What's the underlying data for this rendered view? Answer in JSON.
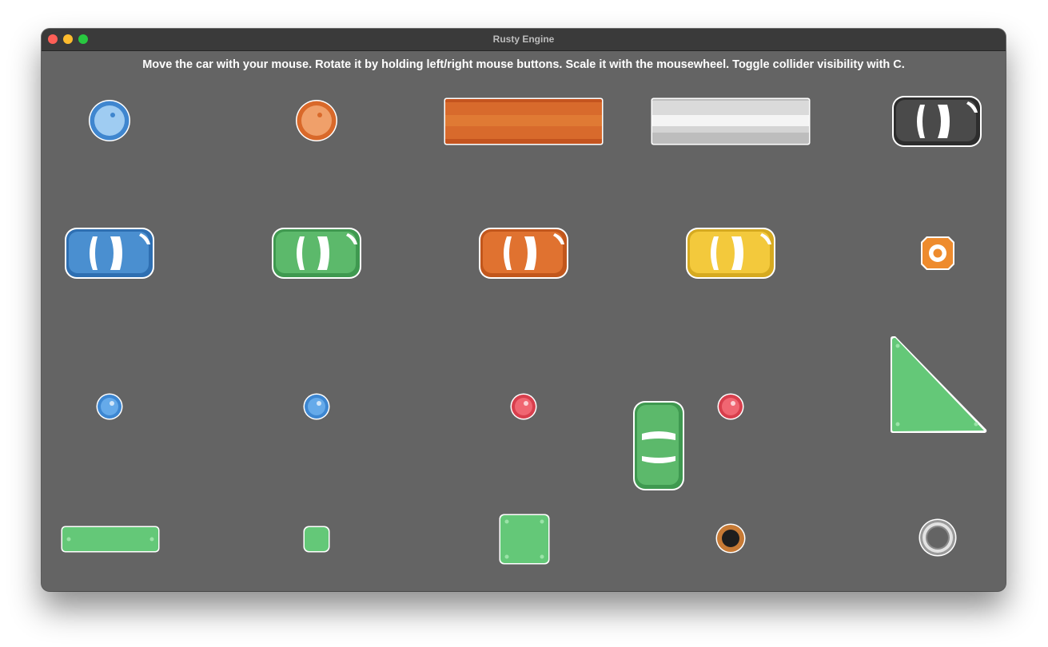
{
  "window": {
    "title": "Rusty Engine",
    "controls": [
      "close",
      "minimize",
      "maximize"
    ]
  },
  "instructions": "Move the car with your mouse. Rotate it by holding left/right mouse buttons. Scale it with the mousewheel. Toggle collider visibility with C.",
  "sprites": [
    {
      "name": "ball-blue-large-icon",
      "color": "#4a90d9"
    },
    {
      "name": "ball-orange-large-icon",
      "color": "#e07a32"
    },
    {
      "name": "barrier-orange-icon",
      "color": "#d5662d"
    },
    {
      "name": "barrier-white-icon",
      "color": "#e6e6e6"
    },
    {
      "name": "car-black-icon",
      "color": "#4a4a4a"
    },
    {
      "name": "car-blue-icon",
      "color": "#4a8fd0"
    },
    {
      "name": "car-green-icon",
      "color": "#5cb96b"
    },
    {
      "name": "car-orange-icon",
      "color": "#e07230"
    },
    {
      "name": "car-yellow-icon",
      "color": "#f3c93c"
    },
    {
      "name": "cone-orange-icon",
      "color": "#f19235"
    },
    {
      "name": "marble-blue-icon",
      "color": "#5aa5e6"
    },
    {
      "name": "marble-blue-icon",
      "color": "#5aa5e6"
    },
    {
      "name": "marble-red-icon",
      "color": "#e8525e"
    },
    {
      "name": "marble-red-icon",
      "color": "#e8525e"
    },
    {
      "name": "triangle-green-icon",
      "color": "#64c878"
    },
    {
      "name": "player-car-green-icon",
      "color": "#5cb96b"
    },
    {
      "name": "block-green-long-icon",
      "color": "#64c878"
    },
    {
      "name": "block-green-small-icon",
      "color": "#64c878"
    },
    {
      "name": "block-green-square-icon",
      "color": "#64c878"
    },
    {
      "name": "hole-black-icon",
      "color": "#1e1e1e"
    },
    {
      "name": "ring-white-icon",
      "color": "#d9d9d9"
    }
  ]
}
